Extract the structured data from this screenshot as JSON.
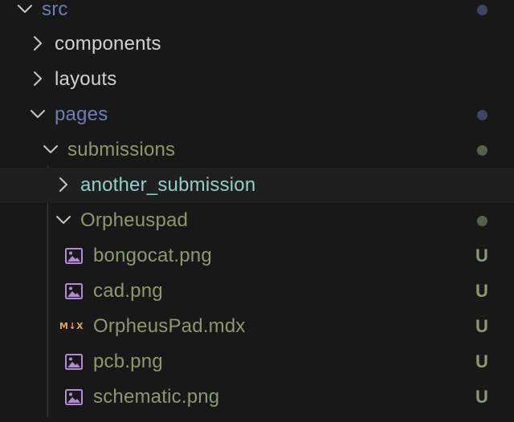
{
  "colors": {
    "background": "#181818",
    "hover_background": "#1f1f1f",
    "folder_text": "#d1d1d1",
    "modified_text": "#6e7eb0",
    "untracked_text": "#8a9a6c",
    "submodule_text": "#8fd0cf",
    "chevron": "#c8c8c8",
    "modified_dot": "#3f4662",
    "untracked_dot": "#56604a",
    "status_u": "#8a9a6c",
    "image_icon": "#b489d6",
    "markdown_icon": "#e0a452"
  },
  "tree": {
    "src": {
      "label": "src",
      "icon": "chevron-down-icon"
    },
    "components": {
      "label": "components",
      "icon": "chevron-right-icon"
    },
    "layouts": {
      "label": "layouts",
      "icon": "chevron-right-icon"
    },
    "pages": {
      "label": "pages",
      "icon": "chevron-down-icon"
    },
    "submissions": {
      "label": "submissions",
      "icon": "chevron-down-icon"
    },
    "another_submission": {
      "label": "another_submission",
      "icon": "chevron-right-icon"
    },
    "orpheuspad": {
      "label": "Orpheuspad",
      "icon": "chevron-down-icon"
    },
    "files": [
      {
        "label": "bongocat.png",
        "icon": "image-file-icon",
        "status": "U"
      },
      {
        "label": "cad.png",
        "icon": "image-file-icon",
        "status": "U"
      },
      {
        "label": "OrpheusPad.mdx",
        "icon": "mdx-file-icon",
        "icon_text": "M↓X",
        "status": "U"
      },
      {
        "label": "pcb.png",
        "icon": "image-file-icon",
        "status": "U"
      },
      {
        "label": "schematic.png",
        "icon": "image-file-icon",
        "status": "U"
      }
    ]
  }
}
